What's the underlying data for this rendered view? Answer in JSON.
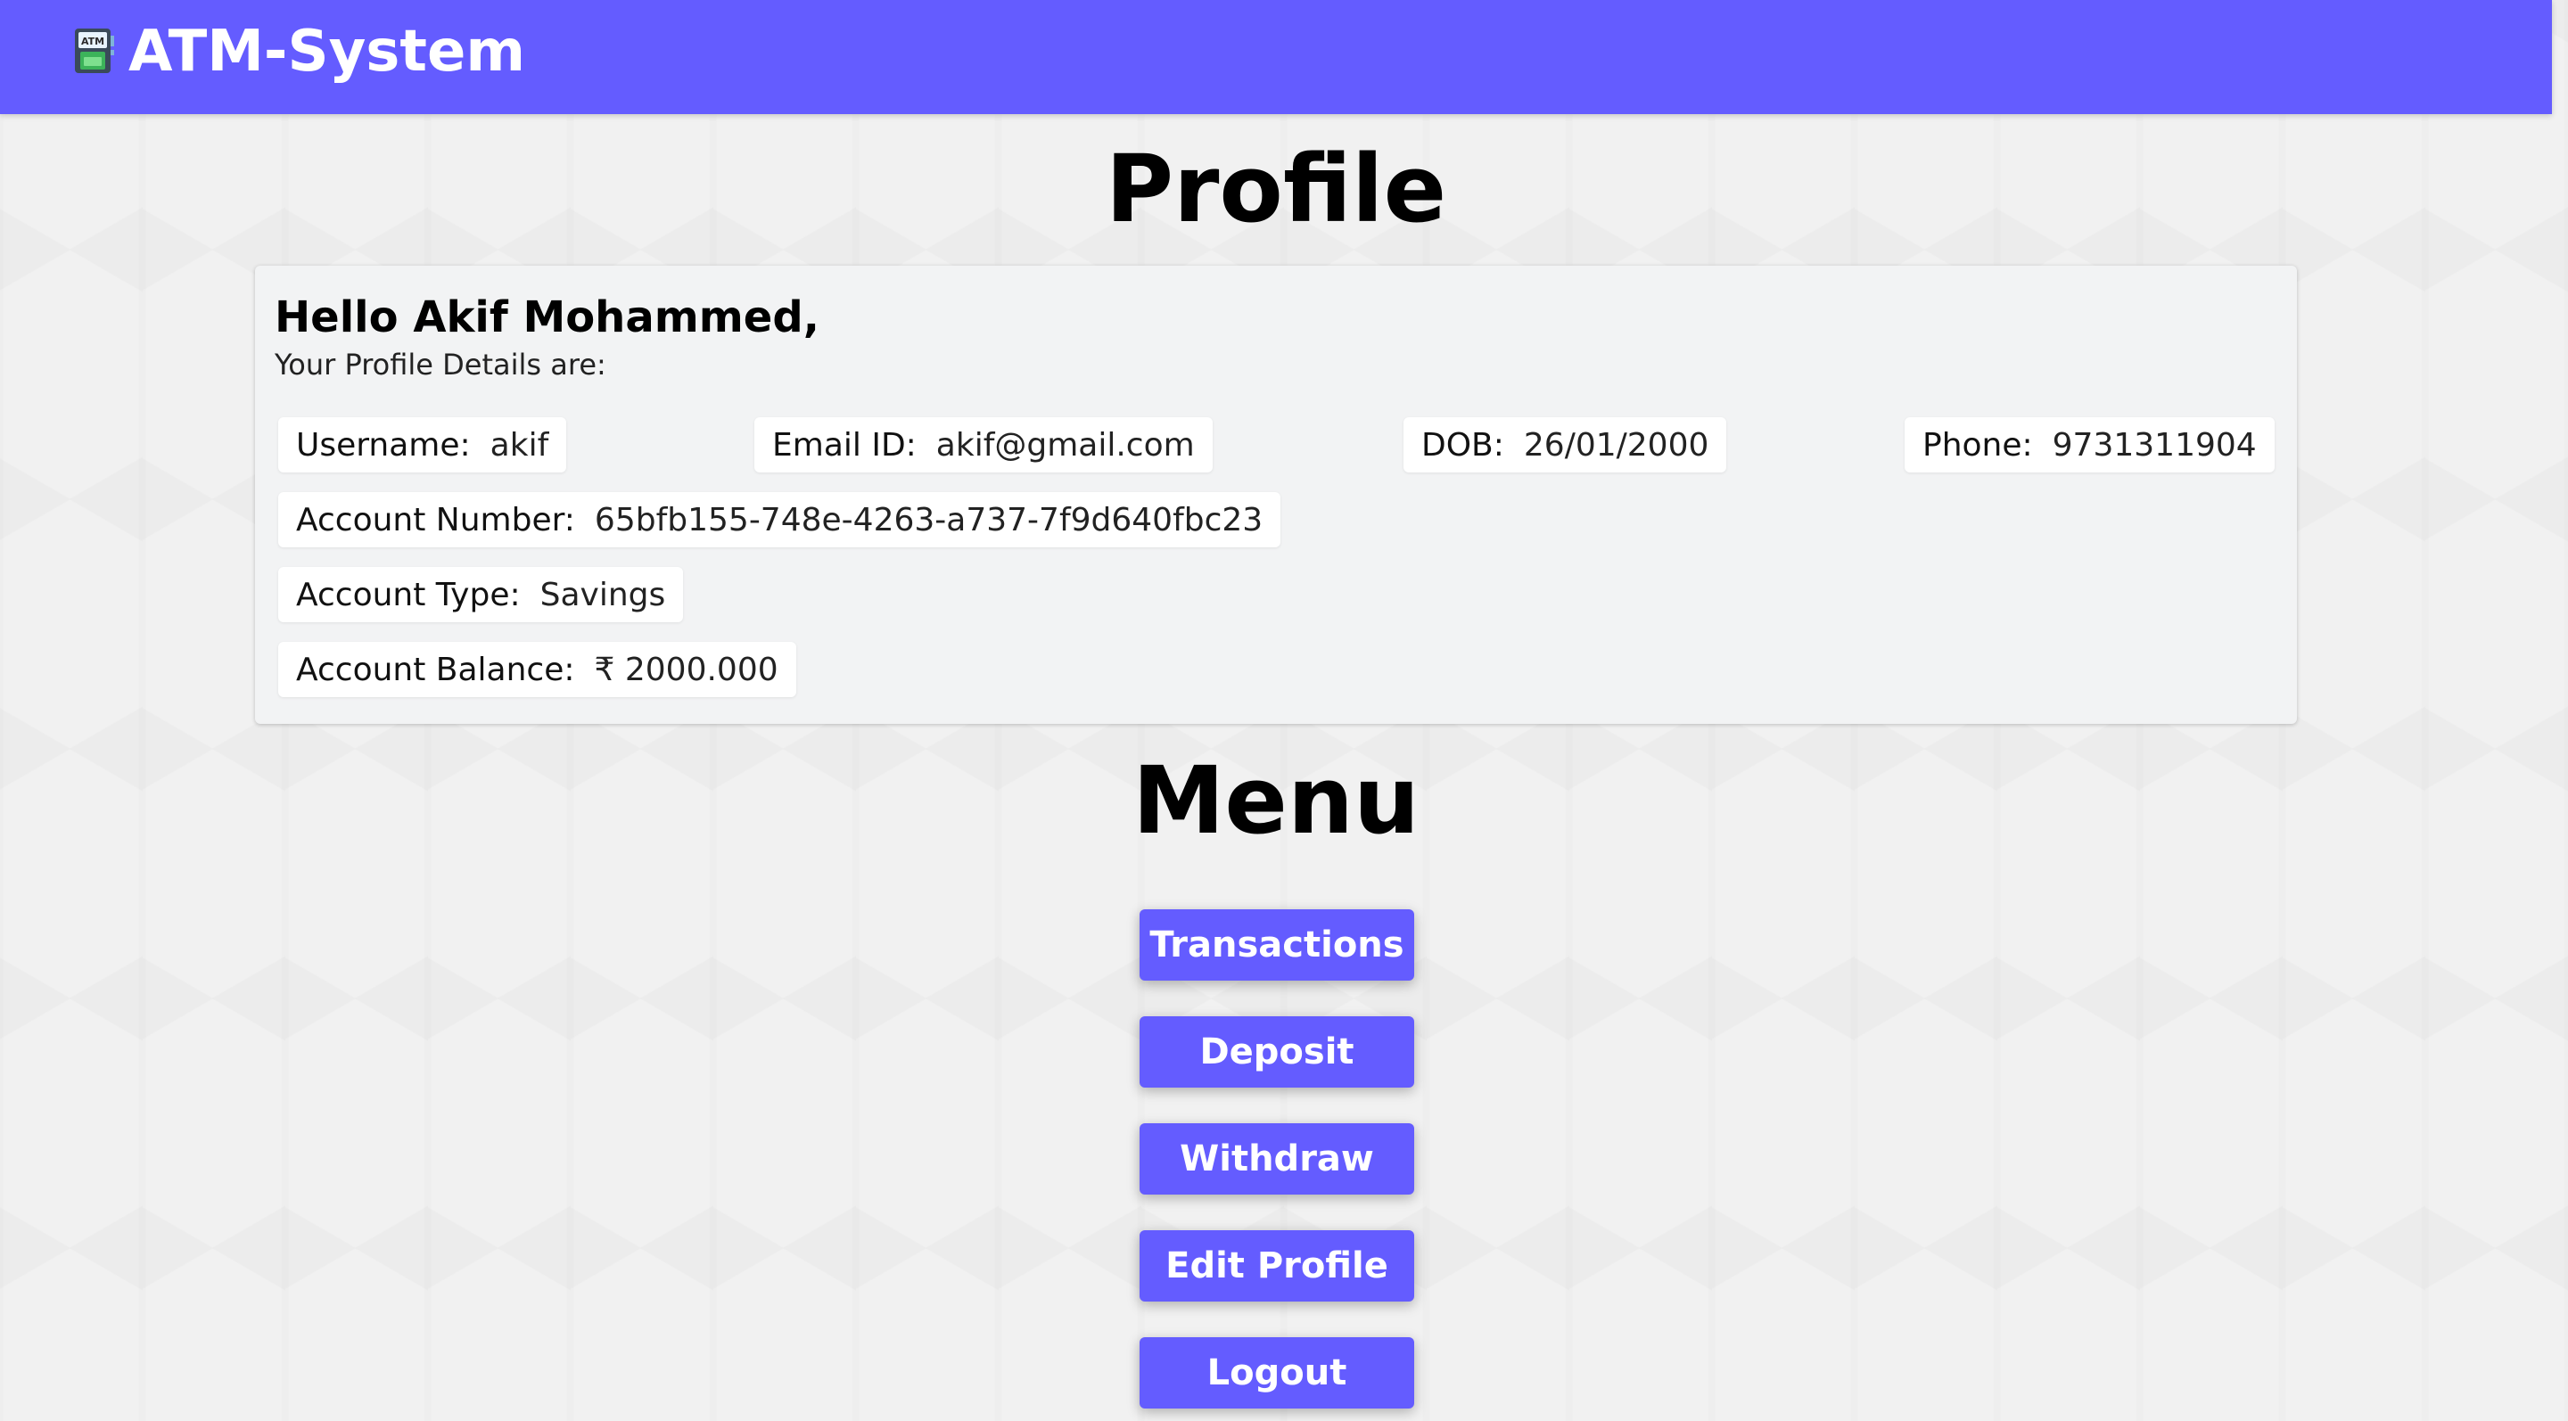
{
  "navbar": {
    "title": "ATM-System",
    "icon": "atm-machine-icon",
    "icon_text": "ATM",
    "color": "#645cff"
  },
  "profile": {
    "heading": "Profile",
    "greeting": "Hello Akif Mohammed,",
    "subtitle": "Your Profile Details are:",
    "fields": {
      "username": {
        "label": "Username:",
        "value": "akif"
      },
      "email": {
        "label": "Email ID:",
        "value": "akif@gmail.com"
      },
      "dob": {
        "label": "DOB:",
        "value": "26/01/2000"
      },
      "phone": {
        "label": "Phone:",
        "value": "9731311904"
      },
      "account_number": {
        "label": "Account Number:",
        "value": "65bfb155-748e-4263-a737-7f9d640fbc23"
      },
      "account_type": {
        "label": "Account Type:",
        "value": "Savings"
      },
      "account_balance": {
        "label": "Account Balance:",
        "value": "₹ 2000.000"
      }
    }
  },
  "menu": {
    "heading": "Menu",
    "buttons": {
      "transactions": "Transactions",
      "deposit": "Deposit",
      "withdraw": "Withdraw",
      "edit_profile": "Edit Profile",
      "logout": "Logout"
    }
  },
  "colors": {
    "accent": "#645cff",
    "background": "#f1f1f1",
    "card": "#f2f3f4"
  }
}
